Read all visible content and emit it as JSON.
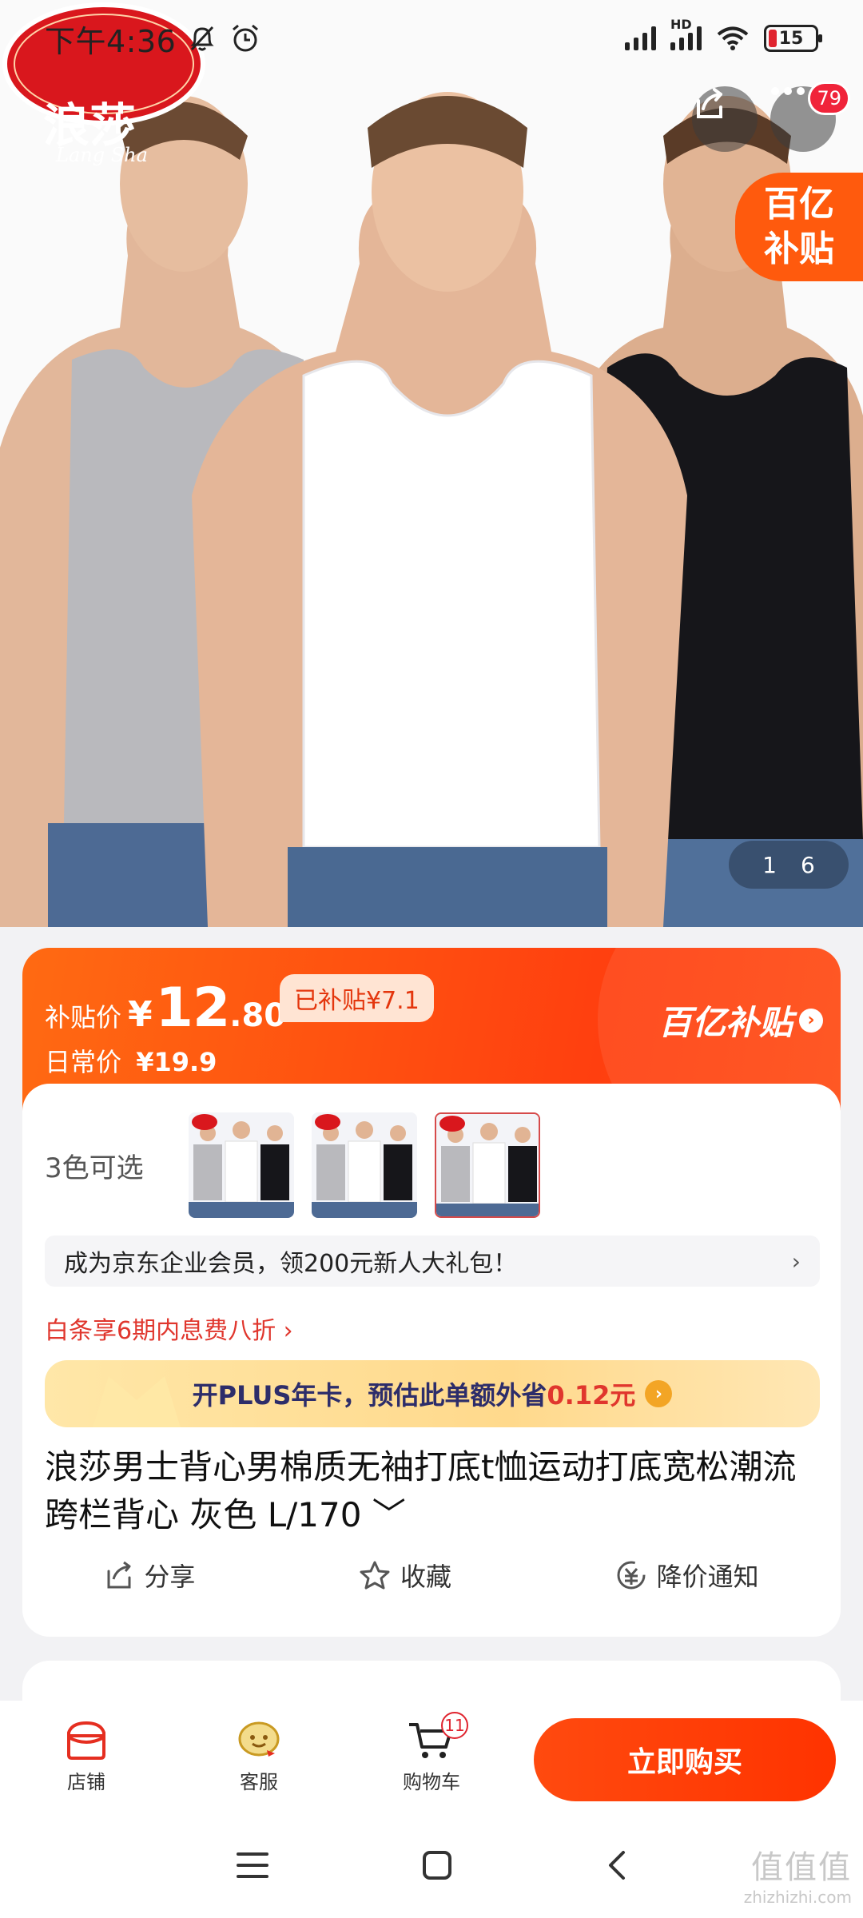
{
  "status_bar": {
    "time": "下午4:36",
    "network": "HD",
    "battery": "15"
  },
  "hero": {
    "brand_logo_text": "浪莎",
    "brand_logo_sub": "Lang Sha",
    "more_badge": "79",
    "subsidy_tag_line1": "百亿",
    "subsidy_tag_line2": "补贴",
    "image_index": "1",
    "image_total": "6"
  },
  "price_card": {
    "subsidy_label": "补贴价",
    "currency": "¥",
    "price_int": "12",
    "price_dec": ".80",
    "subsidy_amount": "已补贴¥7.1",
    "daily_label": "日常价",
    "daily_price": "¥19.9",
    "program_name": "百亿补贴"
  },
  "info_card": {
    "color_label": "3色可选",
    "member_promo": "成为京东企业会员，领200元新人大礼包！",
    "baitiao_promo": "白条享6期内息费八折 ›",
    "plus_prefix": "开PLUS年卡，预估此单额外省",
    "plus_value": "0.12元",
    "title": "浪莎男士背心男棉质无袖打底t恤运动打底宽松潮流跨栏背心 灰色 L/170 ﹀",
    "actions": {
      "share": "分享",
      "favorite": "收藏",
      "price_alert": "降价通知"
    }
  },
  "bottom_bar": {
    "shop": "店铺",
    "service": "客服",
    "cart": "购物车",
    "cart_count": "11",
    "buy_now": "立即购买"
  },
  "watermark": {
    "line1": "值值值",
    "line2": "zhizhizhi.com"
  },
  "colors": {
    "accent": "#ff4a0f",
    "price_red": "#e0362d",
    "plus_gold": "#ffd98c"
  }
}
